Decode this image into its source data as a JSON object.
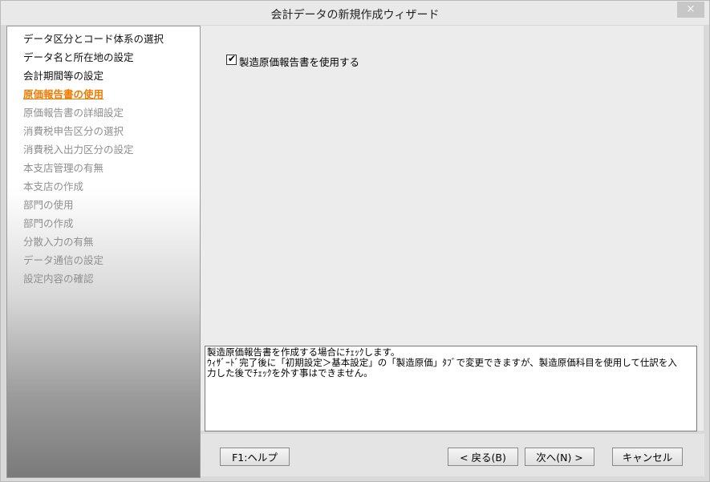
{
  "window": {
    "title": "会計データの新規作成ウィザード",
    "close_label": "×"
  },
  "steps": [
    {
      "label": "データ区分とコード体系の選択",
      "state": "done"
    },
    {
      "label": "データ名と所在地の設定",
      "state": "done"
    },
    {
      "label": "会計期間等の設定",
      "state": "done"
    },
    {
      "label": "原価報告書の使用",
      "state": "current"
    },
    {
      "label": "原価報告書の詳細設定",
      "state": "future"
    },
    {
      "label": "消費税申告区分の選択",
      "state": "future"
    },
    {
      "label": "消費税入出力区分の設定",
      "state": "future"
    },
    {
      "label": "本支店管理の有無",
      "state": "future"
    },
    {
      "label": "本支店の作成",
      "state": "future"
    },
    {
      "label": "部門の使用",
      "state": "future"
    },
    {
      "label": "部門の作成",
      "state": "future"
    },
    {
      "label": "分散入力の有無",
      "state": "future"
    },
    {
      "label": "データ通信の設定",
      "state": "future"
    },
    {
      "label": "設定内容の確認",
      "state": "future"
    }
  ],
  "option": {
    "label": "製造原価報告書を使用する",
    "checked": true,
    "check_glyph": "✔"
  },
  "info": {
    "line1": "製造原価報告書を作成する場合にﾁｪｯｸします。",
    "line2": "ｳｨｻﾞｰﾄﾞ完了後に「初期設定＞基本設定」の「製造原価」ﾀﾌﾞで変更できますが、製造原価科目を使用して仕訳を入",
    "line3": "力した後でﾁｪｯｸを外す事はできません。"
  },
  "buttons": {
    "help": "F1:ヘルプ",
    "back": "< 戻る(B)",
    "next": "次へ(N) >",
    "cancel": "キャンセル"
  }
}
